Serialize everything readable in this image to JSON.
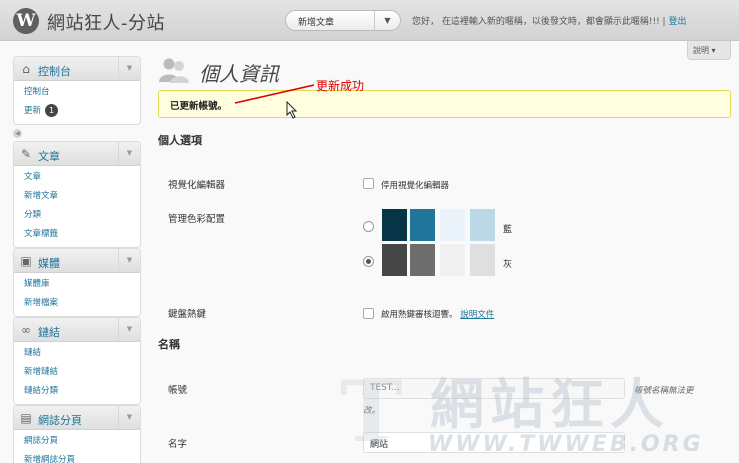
{
  "header": {
    "logo": "W",
    "site_title": "網站狂人-分站",
    "new_post_label": "新增文章",
    "greeting": "您好， 在這裡輸入新的暱稱，以後發文時，都會顯示此暱稱!!! |",
    "logout": "登出"
  },
  "help_tab": "說明 ▾",
  "sidebar": {
    "groups": [
      {
        "title": "控制台",
        "icon": "home-icon",
        "items": [
          {
            "label": "控制台"
          },
          {
            "label": "更新",
            "badge": "1"
          }
        ]
      },
      {
        "title": "文章",
        "icon": "pin-icon",
        "items": [
          {
            "label": "文章"
          },
          {
            "label": "新增文章"
          },
          {
            "label": "分類"
          },
          {
            "label": "文章標籤"
          }
        ]
      },
      {
        "title": "媒體",
        "icon": "media-icon",
        "items": [
          {
            "label": "媒體庫"
          },
          {
            "label": "新增檔案"
          }
        ]
      },
      {
        "title": "鏈結",
        "icon": "link-icon",
        "items": [
          {
            "label": "鏈結"
          },
          {
            "label": "新增鏈結"
          },
          {
            "label": "鏈結分類"
          }
        ]
      },
      {
        "title": "網誌分頁",
        "icon": "page-icon",
        "items": [
          {
            "label": "網誌分頁"
          },
          {
            "label": "新增網誌分頁"
          }
        ]
      }
    ]
  },
  "main": {
    "title": "個人資訊",
    "annotation": "更新成功",
    "notice": "已更新帳號。",
    "personal_options": "個人選項",
    "visual_editor_label": "視覺化編輯器",
    "visual_editor_checkbox": "停用視覺化編輯器",
    "color_scheme_label": "管理色彩配置",
    "schemes": [
      {
        "name": "藍",
        "colors": [
          "#073447",
          "#21759b",
          "#eaf3fa",
          "#bbd8e7"
        ],
        "selected": false
      },
      {
        "name": "灰",
        "colors": [
          "#464646",
          "#6d6d6d",
          "#f1f1f1",
          "#dfdfdf"
        ],
        "selected": true
      }
    ],
    "shortcuts_label": "鍵盤熱鍵",
    "shortcuts_checkbox": "啟用熱鍵審核迴響。",
    "shortcuts_link": "說明文件",
    "name_section": "名稱",
    "username_label": "帳號",
    "username_value": "TEST...",
    "username_desc": "帳號名稱無法更",
    "username_desc2": "改。",
    "firstname_label": "名字",
    "firstname_value": "網站"
  },
  "watermark": {
    "big": "網站狂人",
    "small": "WWW.TWWEB.ORG",
    "letter": "T"
  }
}
